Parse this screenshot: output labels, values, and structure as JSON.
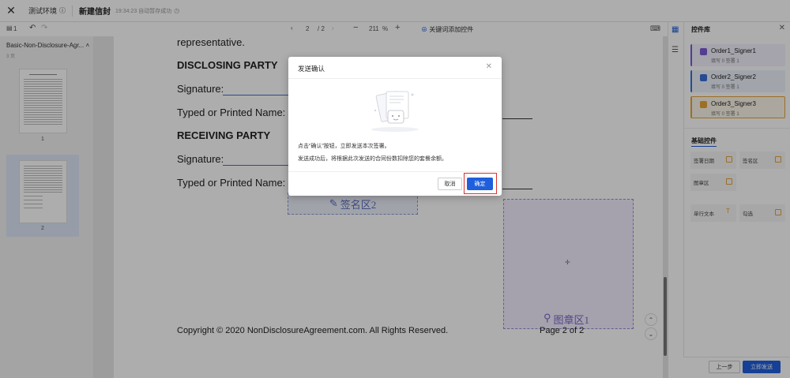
{
  "topbar": {
    "env_label": "测试环境",
    "doc_title": "新建信封",
    "saved_status": "19:34:23 自动暂存成功"
  },
  "subbar": {
    "page_count_icon_label": "1",
    "current_page": "2",
    "total_pages": "/ 2",
    "zoom": "211",
    "zoom_unit": "%",
    "keyword_add": "关键词添加控件"
  },
  "leftpanel": {
    "doc_name": "Basic-Non-Disclosure-Agr...",
    "page_count": "3 页",
    "thumb1_label": "1",
    "thumb2_label": "2"
  },
  "doc": {
    "representative": "representative.",
    "disclosing": "DISCLOSING PARTY",
    "signature1": "Signature: ",
    "typed1": "Typed or Printed Name: ",
    "receiving": "RECEIVING PARTY",
    "signature2": "Signature: ",
    "typed2": "Typed or Printed Name: ",
    "sig_field": "签名区2",
    "seal_field": "图章区1",
    "copyright": "Copyright © 2020 NonDisclosureAgreement.com. All Rights Reserved.",
    "page_label": "Page 2 of 2"
  },
  "rightpanel": {
    "title": "控件库",
    "signers": [
      {
        "name": "Order1_Signer1",
        "stats": "填写 0    签署 1",
        "color": "#7b5cd6"
      },
      {
        "name": "Order2_Signer2",
        "stats": "填写 0    签署 1",
        "color": "#3a6fd8"
      },
      {
        "name": "Order3_Signer3",
        "stats": "填写 0    签署 1",
        "color": "#e6a23c"
      }
    ],
    "basic_controls": "基础控件",
    "controls": [
      "签署日期",
      "签名区",
      "图章区",
      "单行文本",
      "勾选"
    ]
  },
  "bottombar": {
    "prev": "上一步",
    "send": "立即发送"
  },
  "dialog": {
    "title": "发送确认",
    "line1": "点击“确认”按钮，立即发送本次签署。",
    "line2": "发送成功后，将根据此次发送的合同份数扣除您的套餐余额。",
    "cancel": "取消",
    "confirm": "确定"
  }
}
